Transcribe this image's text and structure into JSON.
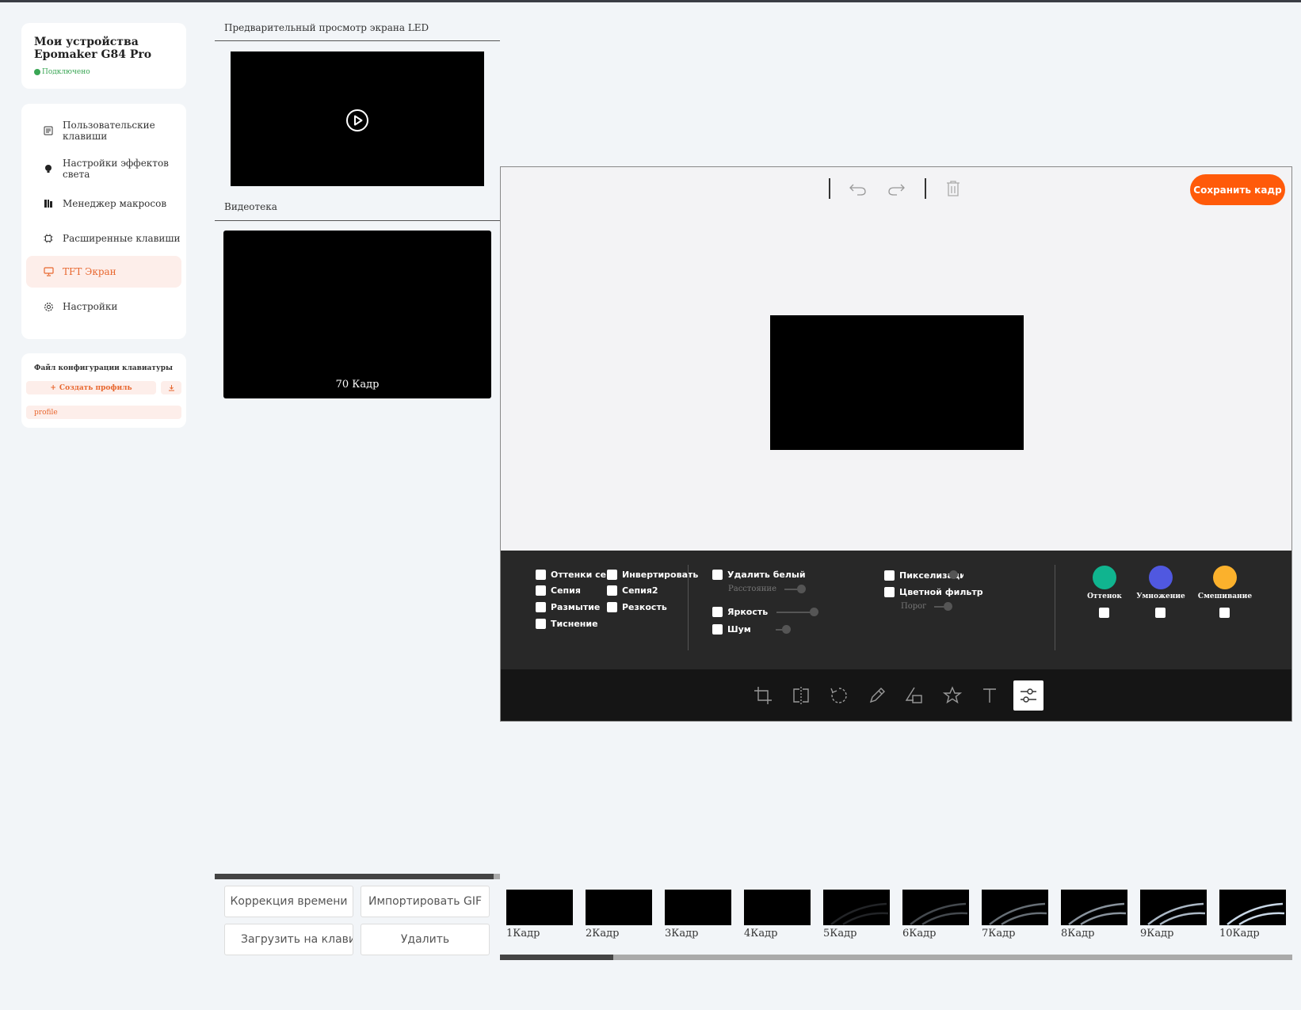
{
  "device": {
    "title": "Мои устройства Epomaker G84 Pro",
    "status": "Подключено"
  },
  "nav": [
    {
      "label": "Пользовательские клавиши",
      "icon": "keyboard-icon"
    },
    {
      "label": "Настройки эффектов света",
      "icon": "light-bulb-icon"
    },
    {
      "label": "Менеджер макросов",
      "icon": "macro-icon"
    },
    {
      "label": "Расширенные клавиши",
      "icon": "chip-icon"
    },
    {
      "label": "TFT Экран",
      "icon": "monitor-icon",
      "active": true
    },
    {
      "label": "Настройки",
      "icon": "gear-icon"
    }
  ],
  "profile": {
    "header": "Файл конфигурации клавиатуры",
    "create_label": "Создать профиль",
    "import_icon": "download-icon",
    "item": "profile"
  },
  "preview": {
    "title": "Предварительный просмотр экрана LED"
  },
  "library": {
    "title": "Видеотека",
    "frame_count": "70 Кадр"
  },
  "editor": {
    "save_label": "Сохранить кадр",
    "filters": {
      "grayscale": "Оттенки серого",
      "invert": "Инвертировать",
      "sepia": "Сепия",
      "sepia2": "Сепия2",
      "blur": "Размытие",
      "sharpen": "Резкость",
      "emboss": "Тиснение",
      "remove_white": "Удалить белый",
      "distance": "Расстояние",
      "brightness": "Яркость",
      "noise": "Шум",
      "pixelate": "Пикселизация",
      "color_filter": "Цветной фильтр",
      "threshold": "Порог"
    },
    "blend": [
      {
        "label": "Оттенок",
        "color": "#10b48f"
      },
      {
        "label": "Умножение",
        "color": "#5058e0"
      },
      {
        "label": "Смешивание",
        "color": "#fbb12c"
      }
    ],
    "tools": [
      "crop-icon",
      "flip-icon",
      "rotate-icon",
      "draw-icon",
      "shape-icon",
      "icon-icon",
      "text-icon",
      "filter-icon"
    ]
  },
  "actions": {
    "time_correction": "Коррекция времени",
    "import_gif": "Импортировать GIF",
    "upload": "Загрузить на клавиатуру",
    "delete": "Удалить"
  },
  "frames": [
    "1Кадр",
    "2Кадр",
    "3Кадр",
    "4Кадр",
    "5Кадр",
    "6Кадр",
    "7Кадр",
    "8Кадр",
    "9Кадр",
    "10Кадр"
  ],
  "colors": {
    "accent": "#ff5a0a",
    "active_bg": "#fdeeea",
    "connected": "#3aa655"
  }
}
